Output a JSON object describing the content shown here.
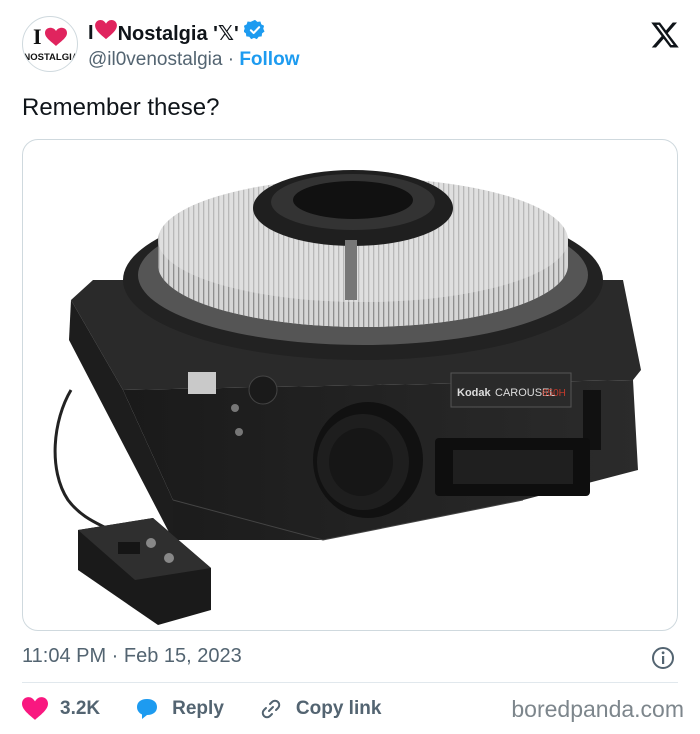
{
  "author": {
    "display_name": "I",
    "display_name_rest": "Nostalgia '𝕏'",
    "handle": "@il0venostalgia",
    "separator": "·",
    "follow_label": "Follow",
    "avatar_text_top": "I",
    "avatar_text_bottom": "NOSTALGIA",
    "heart_color": "#e0245e",
    "verified_color": "#1d9bf0"
  },
  "tweet": {
    "text": "Remember these?",
    "timestamp": "11:04 PM · Feb 15, 2023"
  },
  "media": {
    "image_label_brand": "Kodak",
    "image_label_model": "CAROUSEL",
    "image_label_number": "650H"
  },
  "actions": {
    "like_count": "3.2K",
    "reply_label": "Reply",
    "copy_link_label": "Copy link"
  },
  "watermark": "boredpanda.com",
  "colors": {
    "accent": "#1d9bf0",
    "like": "#f91880",
    "muted": "#536471"
  }
}
